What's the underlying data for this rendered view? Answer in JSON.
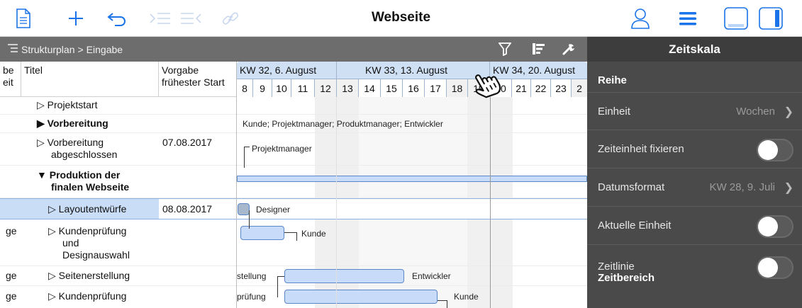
{
  "toolbar": {
    "title": "Webseite",
    "icons": [
      "document-icon",
      "plus-icon",
      "undo-icon",
      "indent-icon",
      "outdent-icon",
      "link-icon",
      "person-icon",
      "menu-icon",
      "bottom-panel-icon",
      "side-panel-icon"
    ]
  },
  "breadcrumb": {
    "root": "Strukturplan",
    "separator": ">",
    "current": "Eingabe"
  },
  "table": {
    "col_partial_top": "be",
    "col_partial_bottom": "eit",
    "col_title": "Titel",
    "col_date_1": "Vorgabe",
    "col_date_2": "frühester Start"
  },
  "timeline": {
    "weeks": [
      "KW 32, 6. August",
      "KW 33, 13. August",
      "KW 34, 20. August"
    ],
    "days": [
      "8",
      "9",
      "10",
      "11",
      "12",
      "13",
      "14",
      "15",
      "16",
      "17",
      "18",
      "19",
      "20",
      "21",
      "22",
      "23",
      "2"
    ]
  },
  "rows": [
    {
      "partial": "",
      "title": "▷ Projektstart",
      "date": "",
      "bold": false
    },
    {
      "partial": "",
      "title": "▶ Vorbereitung",
      "date": "",
      "bold": true
    },
    {
      "partial": "",
      "title": "▷ Vorbereitung",
      "title2": "abgeschlossen",
      "date": "07.08.2017",
      "bold": false
    },
    {
      "partial": "",
      "title": "▼ Produktion der",
      "title2": "finalen Webseite",
      "date": "",
      "bold": true
    },
    {
      "partial": "",
      "title": "▷ Layoutentwürfe",
      "date": "08.08.2017",
      "bold": false
    },
    {
      "partial": "ge",
      "title": "▷ Kundenprüfung",
      "title2": "und",
      "title3": "Designauswahl",
      "date": "",
      "bold": false
    },
    {
      "partial": "ge",
      "title": "▷ Seitenerstellung",
      "date": "",
      "bold": false
    },
    {
      "partial": "ge",
      "title": "▷ Kundenprüfung",
      "date": "",
      "bold": false
    }
  ],
  "gantt": {
    "vorbereitung_resources": "Kunde; Projektmanager; Produktmanager; Entwickler",
    "milestone_label": "Projektmanager",
    "layout_label": "Designer",
    "review_label": "Kunde",
    "seiten_left": "stellung",
    "seiten_right": "Entwickler",
    "kunden_left": "prüfung",
    "kunden_right": "Kunde"
  },
  "panel": {
    "title": "Zeitskala",
    "section_reihe": "Reihe",
    "einheit_label": "Einheit",
    "einheit_value": "Wochen",
    "fixieren_label": "Zeiteinheit fixieren",
    "datumsformat_label": "Datumsformat",
    "datumsformat_value": "KW 28, 9. Juli",
    "aktuelle_label": "Aktuelle Einheit",
    "zeitlinie_label": "Zeitlinie",
    "section_bereich": "Zeitbereich",
    "toggles": {
      "fixieren": false,
      "aktuelle": false,
      "zeitlinie": false
    }
  },
  "colors": {
    "accent": "#1a73e8",
    "bar_fill": "#c8dcfa",
    "bar_stroke": "#5b87c9",
    "panel_bg": "#4a4a4a",
    "header_bg": "#6d6d6d",
    "week_header_bg": "#cfe0f5"
  }
}
